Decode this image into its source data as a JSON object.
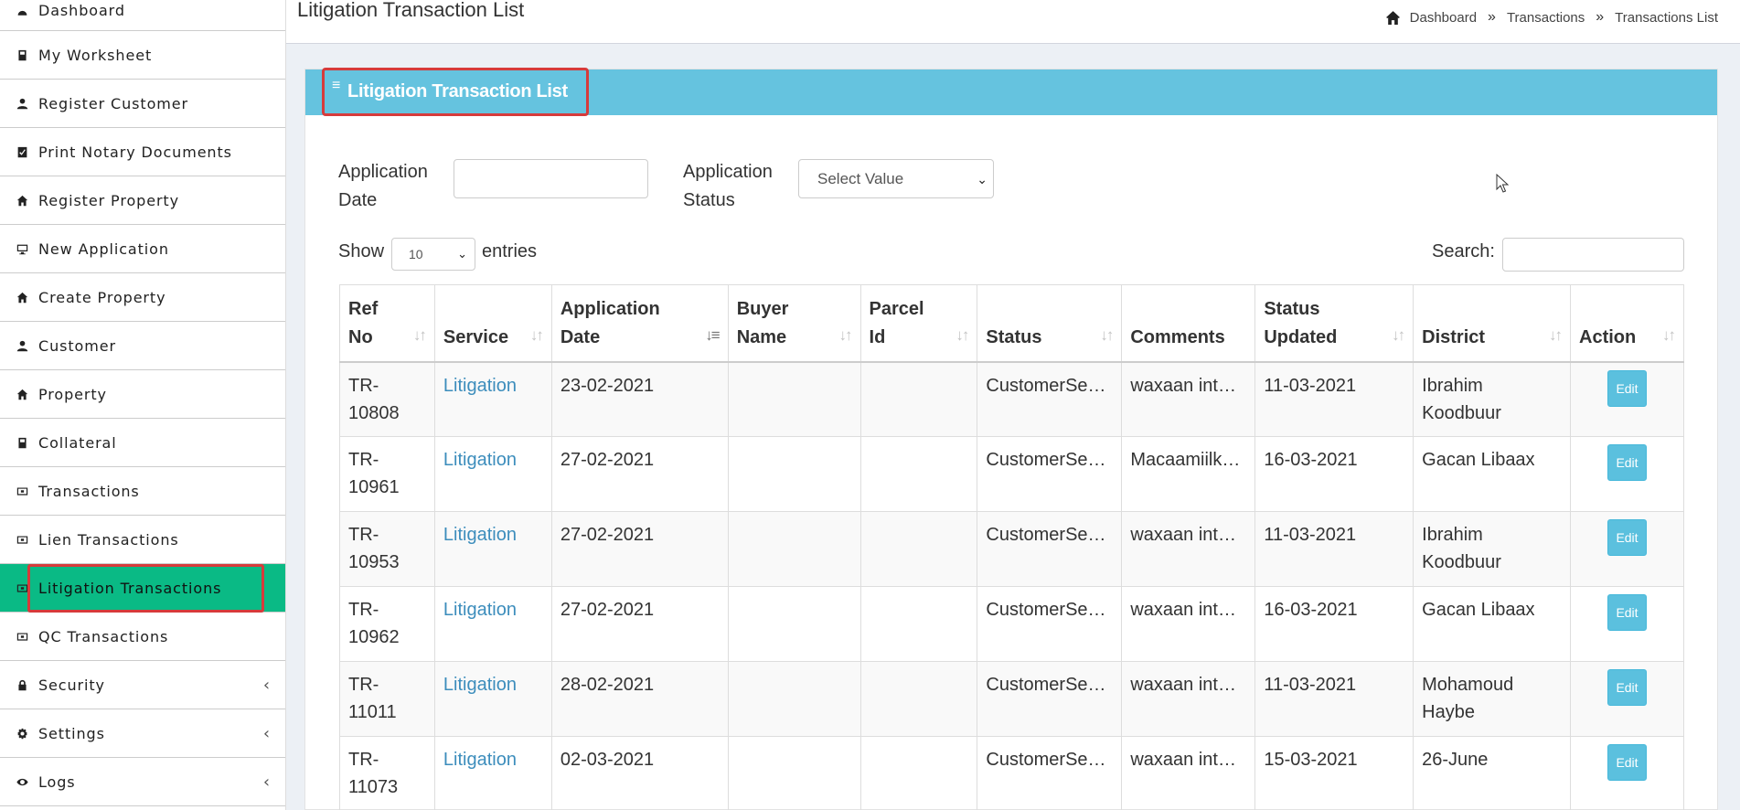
{
  "sidebar": {
    "items": [
      {
        "label": "Dashboard",
        "icon": "dashboard-icon"
      },
      {
        "label": "My Worksheet",
        "icon": "book-icon"
      },
      {
        "label": "Register Customer",
        "icon": "user-icon"
      },
      {
        "label": "Print Notary Documents",
        "icon": "print-icon"
      },
      {
        "label": "Register Property",
        "icon": "home-icon"
      },
      {
        "label": "New Application",
        "icon": "monitor-icon"
      },
      {
        "label": "Create Property",
        "icon": "home-icon"
      },
      {
        "label": "Customer",
        "icon": "user-icon"
      },
      {
        "label": "Property",
        "icon": "home-icon"
      },
      {
        "label": "Collateral",
        "icon": "book-icon"
      },
      {
        "label": "Transactions",
        "icon": "money-icon"
      },
      {
        "label": "Lien Transactions",
        "icon": "money-icon"
      },
      {
        "label": "Litigation Transactions",
        "icon": "money-icon"
      },
      {
        "label": "QC Transactions",
        "icon": "money-icon"
      },
      {
        "label": "Security",
        "icon": "lock-icon"
      },
      {
        "label": "Settings",
        "icon": "gear-icon"
      },
      {
        "label": "Logs",
        "icon": "eye-icon"
      }
    ],
    "chevron": "‹"
  },
  "header": {
    "title": "Litigation Transaction List",
    "breadcrumb": [
      "Dashboard",
      "Transactions",
      "Transactions List"
    ],
    "sep": "»"
  },
  "box": {
    "title": "Litigation Transaction List",
    "bars": "≡"
  },
  "filters": {
    "app_date_label_1": "Application",
    "app_date_label_2": "Date",
    "app_status_label_1": "Application",
    "app_status_label_2": "Status",
    "status_select": "Select Value"
  },
  "length": {
    "show": "Show",
    "value": "10",
    "entries": "entries",
    "search": "Search:"
  },
  "table": {
    "columns": [
      [
        "Ref",
        "No"
      ],
      [
        "",
        "Service"
      ],
      [
        "Application",
        "Date"
      ],
      [
        "Buyer",
        "Name"
      ],
      [
        "Parcel",
        "Id"
      ],
      [
        "",
        "Status"
      ],
      [
        "",
        "Comments"
      ],
      [
        "Status",
        "Updated"
      ],
      [
        "",
        "District"
      ],
      [
        "",
        "Action"
      ]
    ],
    "rows": [
      {
        "ref1": "TR-",
        "ref2": "10808",
        "service": "Litigation",
        "date": "23-02-2021",
        "buyer": "",
        "parcel": "",
        "status": "CustomerSe…",
        "comments": "waxaan int…",
        "updated": "11-03-2021",
        "d1": "Ibrahim",
        "d2": "Koodbuur",
        "action": "Edit"
      },
      {
        "ref1": "TR-",
        "ref2": "10961",
        "service": "Litigation",
        "date": "27-02-2021",
        "buyer": "",
        "parcel": "",
        "status": "CustomerSe…",
        "comments": "Macaamiilk…",
        "updated": "16-03-2021",
        "d1": "Gacan Libaax",
        "d2": "",
        "action": "Edit"
      },
      {
        "ref1": "TR-",
        "ref2": "10953",
        "service": "Litigation",
        "date": "27-02-2021",
        "buyer": "",
        "parcel": "",
        "status": "CustomerSe…",
        "comments": "waxaan int…",
        "updated": "11-03-2021",
        "d1": "Ibrahim",
        "d2": "Koodbuur",
        "action": "Edit"
      },
      {
        "ref1": "TR-",
        "ref2": "10962",
        "service": "Litigation",
        "date": "27-02-2021",
        "buyer": "",
        "parcel": "",
        "status": "CustomerSe…",
        "comments": "waxaan int…",
        "updated": "16-03-2021",
        "d1": "Gacan Libaax",
        "d2": "",
        "action": "Edit"
      },
      {
        "ref1": "TR-",
        "ref2": "11011",
        "service": "Litigation",
        "date": "28-02-2021",
        "buyer": "",
        "parcel": "",
        "status": "CustomerSe…",
        "comments": "waxaan int…",
        "updated": "11-03-2021",
        "d1": "Mohamoud",
        "d2": "Haybe",
        "action": "Edit"
      },
      {
        "ref1": "TR-",
        "ref2": "11073",
        "service": "Litigation",
        "date": "02-03-2021",
        "buyer": "",
        "parcel": "",
        "status": "CustomerSe…",
        "comments": "waxaan int…",
        "updated": "15-03-2021",
        "d1": "26-June",
        "d2": "",
        "action": "Edit"
      }
    ]
  }
}
